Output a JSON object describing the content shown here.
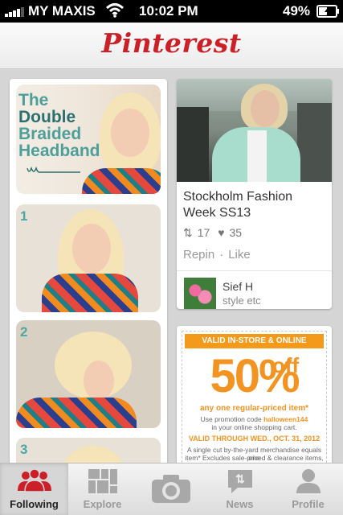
{
  "status_bar": {
    "carrier": "MY MAXIS",
    "time": "10:02 PM",
    "battery": "49%"
  },
  "header": {
    "logo": "Pinterest"
  },
  "left_pin": {
    "title_line1": "The",
    "title_line2": "Double",
    "title_line3": "Braided",
    "title_line4": "Headband",
    "step_numbers": [
      "1",
      "2",
      "3"
    ]
  },
  "right_pin": {
    "title": "Stockholm Fashion Week SS13",
    "repins": "17",
    "likes": "35",
    "repin_label": "Repin",
    "separator": "·",
    "like_label": "Like",
    "pinner_name": "Sief H",
    "board_name": "style etc"
  },
  "coupon": {
    "banner": "VALID IN-STORE & ONLINE",
    "percent": "50%",
    "off": "off",
    "any_item": "any one regular-priced item*",
    "promo_prefix": "Use promotion code",
    "promo_code": "halloween144",
    "promo_suffix": "in your online shopping cart.",
    "valid_through": "VALID THROUGH WED., OCT. 31, 2012",
    "fine_print_1": "A single cut by-the-yard merchandise equals one",
    "fine_print_2": "item* Excludes sale-priced & clearance items,"
  },
  "tabs": [
    {
      "label": "Following",
      "active": true
    },
    {
      "label": "Explore",
      "active": false
    },
    {
      "label": "",
      "active": false
    },
    {
      "label": "News",
      "active": false
    },
    {
      "label": "Profile",
      "active": false
    }
  ],
  "colors": {
    "brand_red": "#cb2027",
    "coupon_orange": "#f39321",
    "title_teal": "#4e9e9a"
  }
}
